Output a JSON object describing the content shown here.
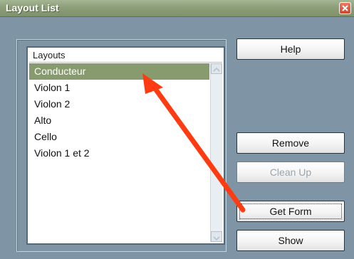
{
  "window": {
    "title": "Layout List"
  },
  "list": {
    "header": "Layouts",
    "items": [
      "Conducteur",
      "Violon 1",
      "Violon 2",
      "Alto",
      "Cello",
      "Violon 1 et 2"
    ],
    "selected_index": 0
  },
  "buttons": {
    "help": "Help",
    "remove": "Remove",
    "clean_up": "Clean Up",
    "get_form": "Get Form",
    "show": "Show"
  },
  "colors": {
    "titlebar": "#8d9f78",
    "dialog_bg": "#7f94a4",
    "selection": "#889b6e",
    "annotation_arrow": "#ff3b12"
  },
  "icons": {
    "close": "close-icon",
    "scroll_up": "chevron-up-icon",
    "scroll_down": "chevron-down-icon",
    "annotation": "red-arrow"
  }
}
